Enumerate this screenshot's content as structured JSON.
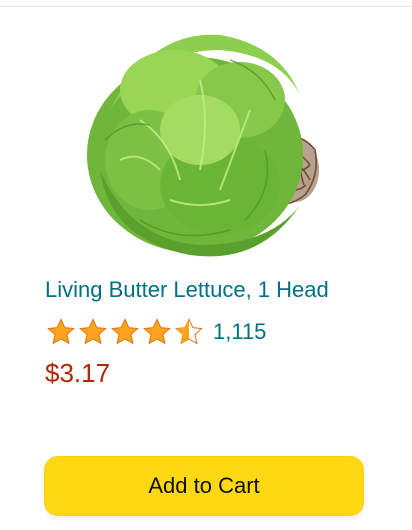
{
  "product": {
    "title": "Living Butter Lettuce, 1 Head",
    "rating": 4.5,
    "rating_max": 5,
    "review_count": "1,115",
    "price": "$3.17",
    "image_icon": "butter-lettuce-image"
  },
  "actions": {
    "add_to_cart_label": "Add to Cart"
  },
  "colors": {
    "link": "#007185",
    "price": "#b12704",
    "star": "#ffa41c",
    "star_outline": "#de7921",
    "button": "#ffd814"
  }
}
